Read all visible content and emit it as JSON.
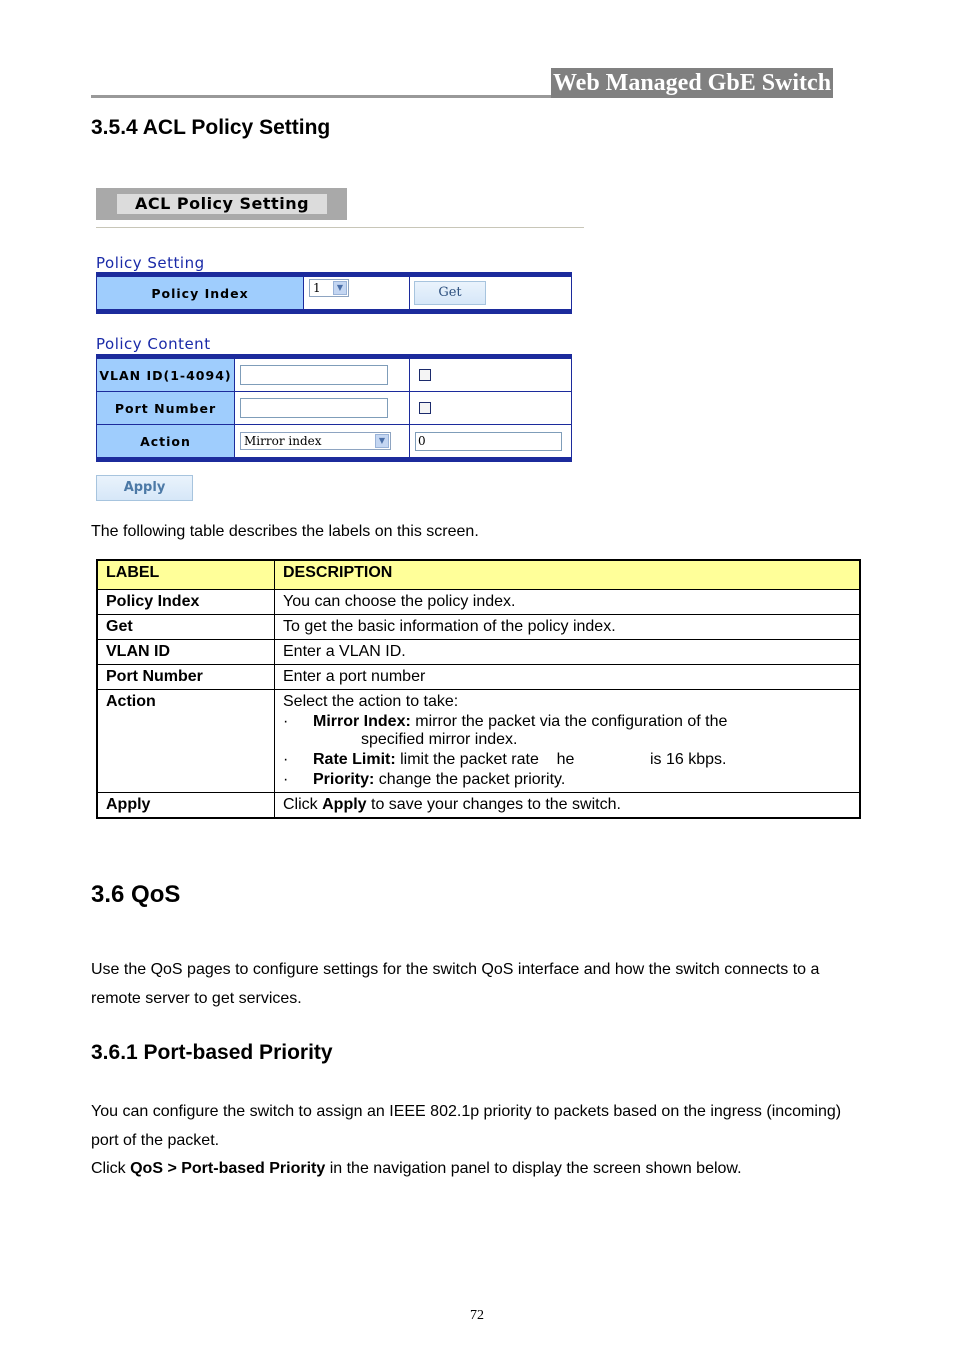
{
  "header": {
    "title": "Web Managed GbE Switch"
  },
  "section_354": {
    "heading": "3.5.4 ACL Policy Setting"
  },
  "ui": {
    "title": "ACL Policy Setting",
    "policy_setting": {
      "section_label": "Policy Setting",
      "index_label": "Policy Index",
      "index_value": "1",
      "get_button": "Get"
    },
    "policy_content": {
      "section_label": "Policy Content",
      "vlan_label": "VLAN ID(1-4094)",
      "vlan_value": "",
      "vlan_checked": false,
      "port_label": "Port Number",
      "port_value": "",
      "port_checked": false,
      "action_label": "Action",
      "action_value": "Mirror index",
      "action_param": "0"
    },
    "apply_button": "Apply"
  },
  "intro_text": "The following table describes the labels on this screen.",
  "desc_table": {
    "headers": [
      "LABEL",
      "DESCRIPTION"
    ],
    "rows": [
      {
        "label": "Policy Index",
        "description": "You can choose the policy index."
      },
      {
        "label": "Get",
        "description": "To get the basic information of the policy index."
      },
      {
        "label": "VLAN ID",
        "description": "Enter a VLAN ID."
      },
      {
        "label": "Port Number",
        "description": "Enter a port number"
      }
    ],
    "action": {
      "label": "Action",
      "intro": "Select the action to take:",
      "bullets": [
        {
          "term": "Mirror Index:",
          "text": " mirror the packet via the configuration of the",
          "cont": "specified mirror index."
        },
        {
          "term": "Rate Limit:",
          "text": " limit the packet rate    he                 is 16 kbps."
        },
        {
          "term": "Priority:",
          "text": " change the packet priority."
        }
      ]
    },
    "apply": {
      "label": "Apply",
      "pre": "Click ",
      "bold": "Apply",
      "post": " to save your changes to the switch."
    }
  },
  "section_36": {
    "heading": "3.6 QoS",
    "text": "Use the QoS pages to configure settings for the switch QoS interface and how the switch connects to a remote server to get services."
  },
  "section_361": {
    "heading": "3.6.1 Port-based Priority",
    "text": "You can configure the switch to assign an IEEE 802.1p priority to packets based on the ingress (incoming) port of the packet.",
    "click_pre": "Click ",
    "click_bold": "QoS > Port-based Priority",
    "click_post": " in the navigation panel to display the screen shown below."
  },
  "footer": {
    "page_number": "72"
  }
}
